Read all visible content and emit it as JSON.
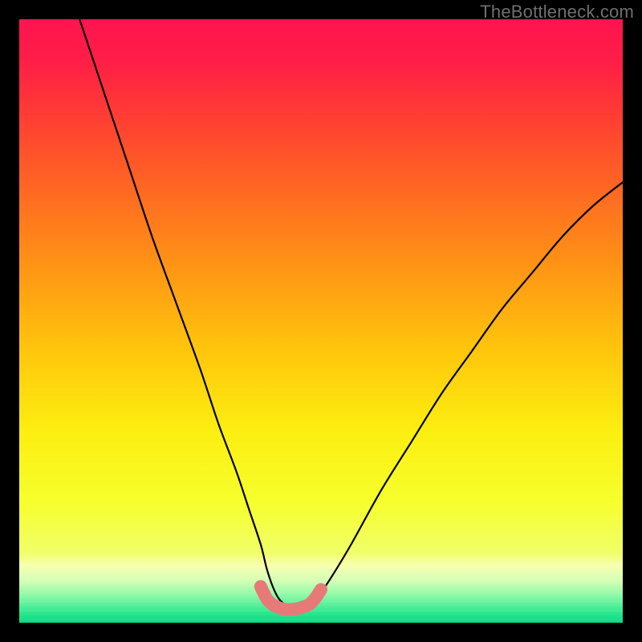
{
  "watermark": "TheBottleneck.com",
  "chart_data": {
    "type": "line",
    "title": "",
    "xlabel": "",
    "ylabel": "",
    "xlim": [
      0,
      100
    ],
    "ylim": [
      0,
      100
    ],
    "series": [
      {
        "name": "primary-curve",
        "x": [
          10,
          14,
          18,
          22,
          26,
          30,
          33,
          36,
          38,
          40,
          41,
          42,
          43,
          44,
          45,
          46,
          47,
          48,
          49,
          50,
          52,
          55,
          60,
          65,
          70,
          75,
          80,
          85,
          90,
          95,
          100
        ],
        "values": [
          100,
          88,
          76,
          64,
          53,
          42,
          33,
          25,
          19,
          13,
          9,
          6,
          4,
          3,
          2,
          2,
          2,
          3,
          4,
          5,
          8,
          13,
          22,
          30,
          38,
          45,
          52,
          58,
          64,
          69,
          73
        ]
      },
      {
        "name": "bottom-band-upper",
        "x": [
          0,
          100
        ],
        "values": [
          9,
          9
        ]
      },
      {
        "name": "bottom-band-lower",
        "x": [
          0,
          100
        ],
        "values": [
          0,
          0
        ]
      },
      {
        "name": "trough-highlight",
        "x": [
          40,
          41,
          42,
          43,
          44,
          45,
          46,
          47,
          48,
          49,
          50
        ],
        "values": [
          6,
          4,
          3,
          2.5,
          2.2,
          2.2,
          2.3,
          2.6,
          3,
          4,
          5.5
        ]
      }
    ],
    "trough_color": "#e77a79",
    "curve_color": "#000000",
    "gradient_stops": [
      {
        "offset": 0.0,
        "color": "#ff1450"
      },
      {
        "offset": 0.07,
        "color": "#ff1e46"
      },
      {
        "offset": 0.18,
        "color": "#ff4430"
      },
      {
        "offset": 0.3,
        "color": "#ff6e20"
      },
      {
        "offset": 0.42,
        "color": "#ff9814"
      },
      {
        "offset": 0.55,
        "color": "#ffc60c"
      },
      {
        "offset": 0.68,
        "color": "#fcee10"
      },
      {
        "offset": 0.8,
        "color": "#f6ff2c"
      },
      {
        "offset": 0.885,
        "color": "#f0ff6a"
      },
      {
        "offset": 0.905,
        "color": "#f7ffb0"
      },
      {
        "offset": 0.93,
        "color": "#d4ffb4"
      },
      {
        "offset": 0.955,
        "color": "#8cf9a8"
      },
      {
        "offset": 0.985,
        "color": "#28e78e"
      },
      {
        "offset": 1.0,
        "color": "#0cd884"
      }
    ]
  }
}
